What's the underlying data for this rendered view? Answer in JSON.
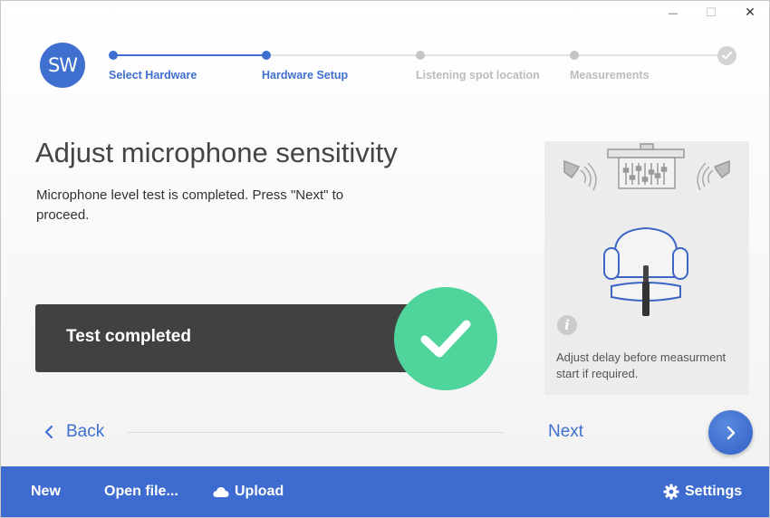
{
  "window": {
    "minimize_glyph": "—",
    "maximize_glyph": "☐",
    "close_glyph": "✕"
  },
  "logo": {
    "text": "SW"
  },
  "steps": [
    {
      "label": "Select Hardware",
      "state": "done"
    },
    {
      "label": "Hardware Setup",
      "state": "current"
    },
    {
      "label": "Listening spot location",
      "state": "pending"
    },
    {
      "label": "Measurements",
      "state": "pending"
    }
  ],
  "main": {
    "title": "Adjust microphone sensitivity",
    "description": "Microphone level test is completed. Press \"Next\" to proceed.",
    "status": "Test completed"
  },
  "panel": {
    "info_glyph": "i",
    "text": "Adjust delay before measurment start if required."
  },
  "nav": {
    "back_label": "Back",
    "next_label": "Next"
  },
  "footer": {
    "new_label": "New",
    "open_label": "Open file...",
    "upload_label": "Upload",
    "settings_label": "Settings"
  },
  "colors": {
    "accent": "#3f6fcf",
    "success": "#4fd49c",
    "status_bg": "#414141",
    "footer": "#3d6bcf"
  }
}
